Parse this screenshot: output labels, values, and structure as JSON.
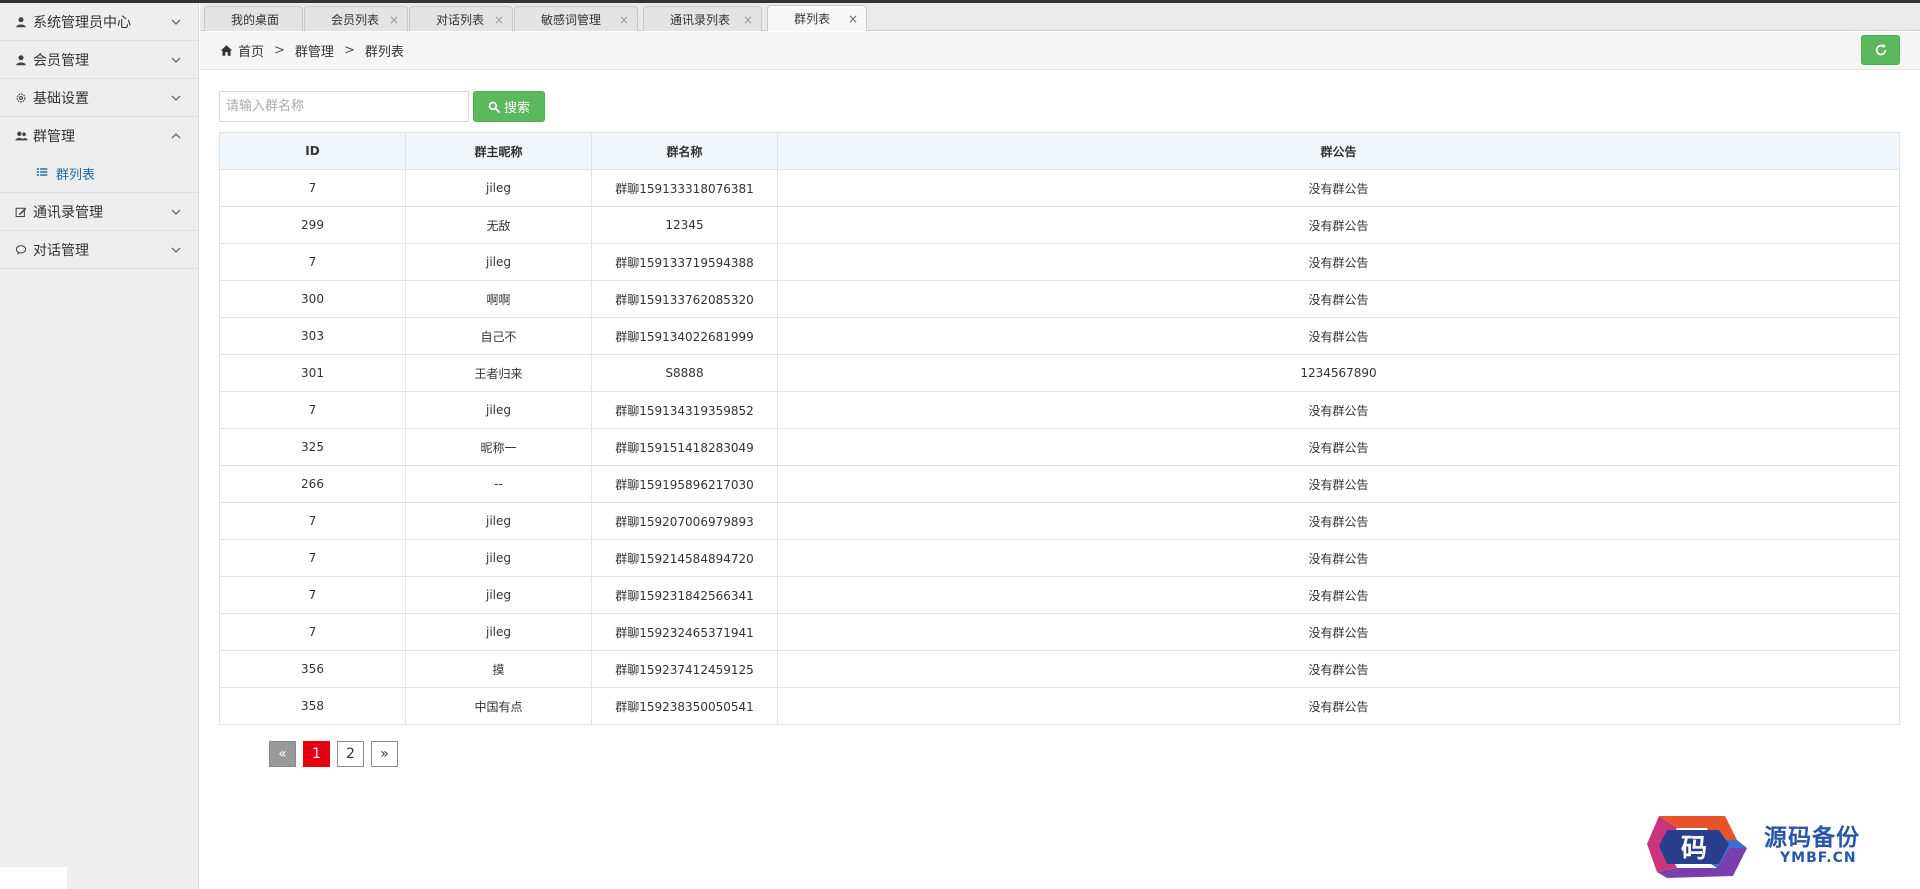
{
  "sidebar": {
    "groups": [
      {
        "label": "系统管理员中心",
        "icon": "user-icon",
        "expanded": false
      },
      {
        "label": "会员管理",
        "icon": "user-icon",
        "expanded": false
      },
      {
        "label": "基础设置",
        "icon": "gear-icon",
        "expanded": false
      },
      {
        "label": "群管理",
        "icon": "users-icon",
        "expanded": true,
        "items": [
          {
            "label": "群列表",
            "icon": "list-icon"
          }
        ]
      },
      {
        "label": "通讯录管理",
        "icon": "edit-icon",
        "expanded": false
      },
      {
        "label": "对话管理",
        "icon": "chat-icon",
        "expanded": false
      }
    ]
  },
  "tabs": [
    {
      "label": "我的桌面",
      "closable": false,
      "active": false
    },
    {
      "label": "会员列表",
      "closable": true,
      "active": false
    },
    {
      "label": "对话列表",
      "closable": true,
      "active": false
    },
    {
      "label": "敏感词管理",
      "closable": true,
      "active": false
    },
    {
      "label": "通讯录列表",
      "closable": true,
      "active": false
    },
    {
      "label": "群列表",
      "closable": true,
      "active": true
    }
  ],
  "close_glyph": "×",
  "breadcrumb": {
    "home": "首页",
    "sep": ">",
    "level1": "群管理",
    "level2": "群列表"
  },
  "search": {
    "placeholder": "请输入群名称",
    "value": "",
    "button_label": "搜索"
  },
  "table": {
    "headers": [
      "ID",
      "群主昵称",
      "群名称",
      "群公告"
    ],
    "rows": [
      [
        "7",
        "jileg",
        "群聊159133318076381",
        "没有群公告"
      ],
      [
        "299",
        "无敌",
        "12345",
        "没有群公告"
      ],
      [
        "7",
        "jileg",
        "群聊159133719594388",
        "没有群公告"
      ],
      [
        "300",
        "啊啊",
        "群聊159133762085320",
        "没有群公告"
      ],
      [
        "303",
        "自己不",
        "群聊159134022681999",
        "没有群公告"
      ],
      [
        "301",
        "王者归来",
        "S8888",
        "1234567890"
      ],
      [
        "7",
        "jileg",
        "群聊159134319359852",
        "没有群公告"
      ],
      [
        "325",
        "昵称一",
        "群聊159151418283049",
        "没有群公告"
      ],
      [
        "266",
        "--",
        "群聊159195896217030",
        "没有群公告"
      ],
      [
        "7",
        "jileg",
        "群聊159207006979893",
        "没有群公告"
      ],
      [
        "7",
        "jileg",
        "群聊159214584894720",
        "没有群公告"
      ],
      [
        "7",
        "jileg",
        "群聊159231842566341",
        "没有群公告"
      ],
      [
        "7",
        "jileg",
        "群聊159232465371941",
        "没有群公告"
      ],
      [
        "356",
        "摸",
        "群聊159237412459125",
        "没有群公告"
      ],
      [
        "358",
        "中国有点",
        "群聊159238350050541",
        "没有群公告"
      ]
    ]
  },
  "pagination": {
    "prev": "«",
    "pages": [
      "1",
      "2"
    ],
    "current": "1",
    "next": "»"
  },
  "watermark": {
    "title": "源码备份",
    "subtitle": "YMBF.CN",
    "logo_char": "码"
  },
  "colors": {
    "accent_green": "#5cb85c",
    "page_active": "#e5000f",
    "link_blue": "#1e6ea7",
    "header_bg": "#f1f6fb"
  }
}
